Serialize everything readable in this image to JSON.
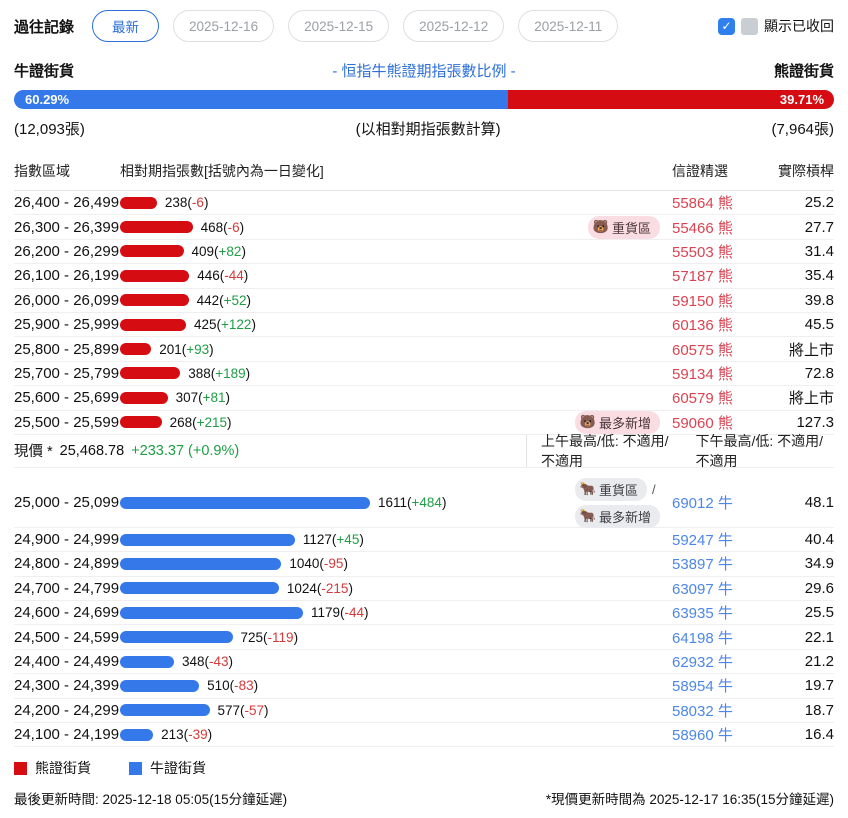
{
  "colors": {
    "bull": "#3478e9",
    "bear": "#d50c11",
    "bull_text": "#4d87e6",
    "bear_text": "#d94452",
    "pos": "#1d9e45",
    "neg": "#d43a3a",
    "accent": "#2e6fd8"
  },
  "header": {
    "history_label": "過往記錄",
    "buttons": [
      {
        "label": "最新",
        "active": true
      },
      {
        "label": "2025-12-16",
        "active": false
      },
      {
        "label": "2025-12-15",
        "active": false
      },
      {
        "label": "2025-12-12",
        "active": false
      },
      {
        "label": "2025-12-11",
        "active": false
      }
    ],
    "show_recalled_label": "顯示已收回",
    "checkbox_checked": true,
    "check_glyph": "✓"
  },
  "ratio": {
    "bull_label": "牛證街貨",
    "title": "- 恒指牛熊證期指張數比例 -",
    "bear_label": "熊證街貨",
    "bull_pct": "60.29%",
    "bear_pct": "39.71%",
    "bull_pct_value": 60.29,
    "bull_count": "(12,093張)",
    "note": "(以相對期指張數計算)",
    "bear_count": "(7,964張)"
  },
  "table": {
    "headers": {
      "range": "指數區域",
      "contracts": "相對期指張數[括號內為一日變化]",
      "pick": "信證精選",
      "leverage": "實際槓桿"
    },
    "badge_emoji": {
      "bear": "🐻",
      "bull": "🐂"
    },
    "bear_rows": [
      {
        "range": "26,400 - 26,499",
        "value": 238,
        "change": "-6",
        "badges": [],
        "pick": "55864 熊",
        "leverage": "25.2"
      },
      {
        "range": "26,300 - 26,399",
        "value": 468,
        "change": "-6",
        "badges": [
          "重貨區"
        ],
        "pick": "55466 熊",
        "leverage": "27.7"
      },
      {
        "range": "26,200 - 26,299",
        "value": 409,
        "change": "+82",
        "badges": [],
        "pick": "55503 熊",
        "leverage": "31.4"
      },
      {
        "range": "26,100 - 26,199",
        "value": 446,
        "change": "-44",
        "badges": [],
        "pick": "57187 熊",
        "leverage": "35.4"
      },
      {
        "range": "26,000 - 26,099",
        "value": 442,
        "change": "+52",
        "badges": [],
        "pick": "59150 熊",
        "leverage": "39.8"
      },
      {
        "range": "25,900 - 25,999",
        "value": 425,
        "change": "+122",
        "badges": [],
        "pick": "60136 熊",
        "leverage": "45.5"
      },
      {
        "range": "25,800 - 25,899",
        "value": 201,
        "change": "+93",
        "badges": [],
        "pick": "60575 熊",
        "leverage": "將上市"
      },
      {
        "range": "25,700 - 25,799",
        "value": 388,
        "change": "+189",
        "badges": [],
        "pick": "59134 熊",
        "leverage": "72.8"
      },
      {
        "range": "25,600 - 25,699",
        "value": 307,
        "change": "+81",
        "badges": [],
        "pick": "60579 熊",
        "leverage": "將上市"
      },
      {
        "range": "25,500 - 25,599",
        "value": 268,
        "change": "+215",
        "badges": [
          "最多新增"
        ],
        "pick": "59060 熊",
        "leverage": "127.3"
      }
    ],
    "bull_rows": [
      {
        "range": "25,000 - 25,099",
        "value": 1611,
        "change": "+484",
        "badges": [
          "重貨區",
          "最多新增"
        ],
        "pick": "69012 牛",
        "leverage": "48.1"
      },
      {
        "range": "24,900 - 24,999",
        "value": 1127,
        "change": "+45",
        "badges": [],
        "pick": "59247 牛",
        "leverage": "40.4"
      },
      {
        "range": "24,800 - 24,899",
        "value": 1040,
        "change": "-95",
        "badges": [],
        "pick": "53897 牛",
        "leverage": "34.9"
      },
      {
        "range": "24,700 - 24,799",
        "value": 1024,
        "change": "-215",
        "badges": [],
        "pick": "63097 牛",
        "leverage": "29.6"
      },
      {
        "range": "24,600 - 24,699",
        "value": 1179,
        "change": "-44",
        "badges": [],
        "pick": "63935 牛",
        "leverage": "25.5"
      },
      {
        "range": "24,500 - 24,599",
        "value": 725,
        "change": "-119",
        "badges": [],
        "pick": "64198 牛",
        "leverage": "22.1"
      },
      {
        "range": "24,400 - 24,499",
        "value": 348,
        "change": "-43",
        "badges": [],
        "pick": "62932 牛",
        "leverage": "21.2"
      },
      {
        "range": "24,300 - 24,399",
        "value": 510,
        "change": "-83",
        "badges": [],
        "pick": "58954 牛",
        "leverage": "19.7"
      },
      {
        "range": "24,200 - 24,299",
        "value": 577,
        "change": "-57",
        "badges": [],
        "pick": "58032 牛",
        "leverage": "18.7"
      },
      {
        "range": "24,100 - 24,199",
        "value": 213,
        "change": "-39",
        "badges": [],
        "pick": "58960 牛",
        "leverage": "16.4"
      }
    ]
  },
  "price": {
    "label": "現價 *",
    "value": "25,468.78",
    "change": "+233.37 (+0.9%)",
    "am": "上午最高/低: 不適用/不適用",
    "pm": "下午最高/低: 不適用/不適用"
  },
  "footer": {
    "legend": [
      {
        "label": "熊證街貨",
        "color_key": "bear"
      },
      {
        "label": "牛證街貨",
        "color_key": "bull"
      }
    ],
    "updated_left": "最後更新時間: 2025-12-18 05:05(15分鐘延遲)",
    "updated_right": "*現價更新時間為 2025-12-17 16:35(15分鐘延遲)"
  }
}
